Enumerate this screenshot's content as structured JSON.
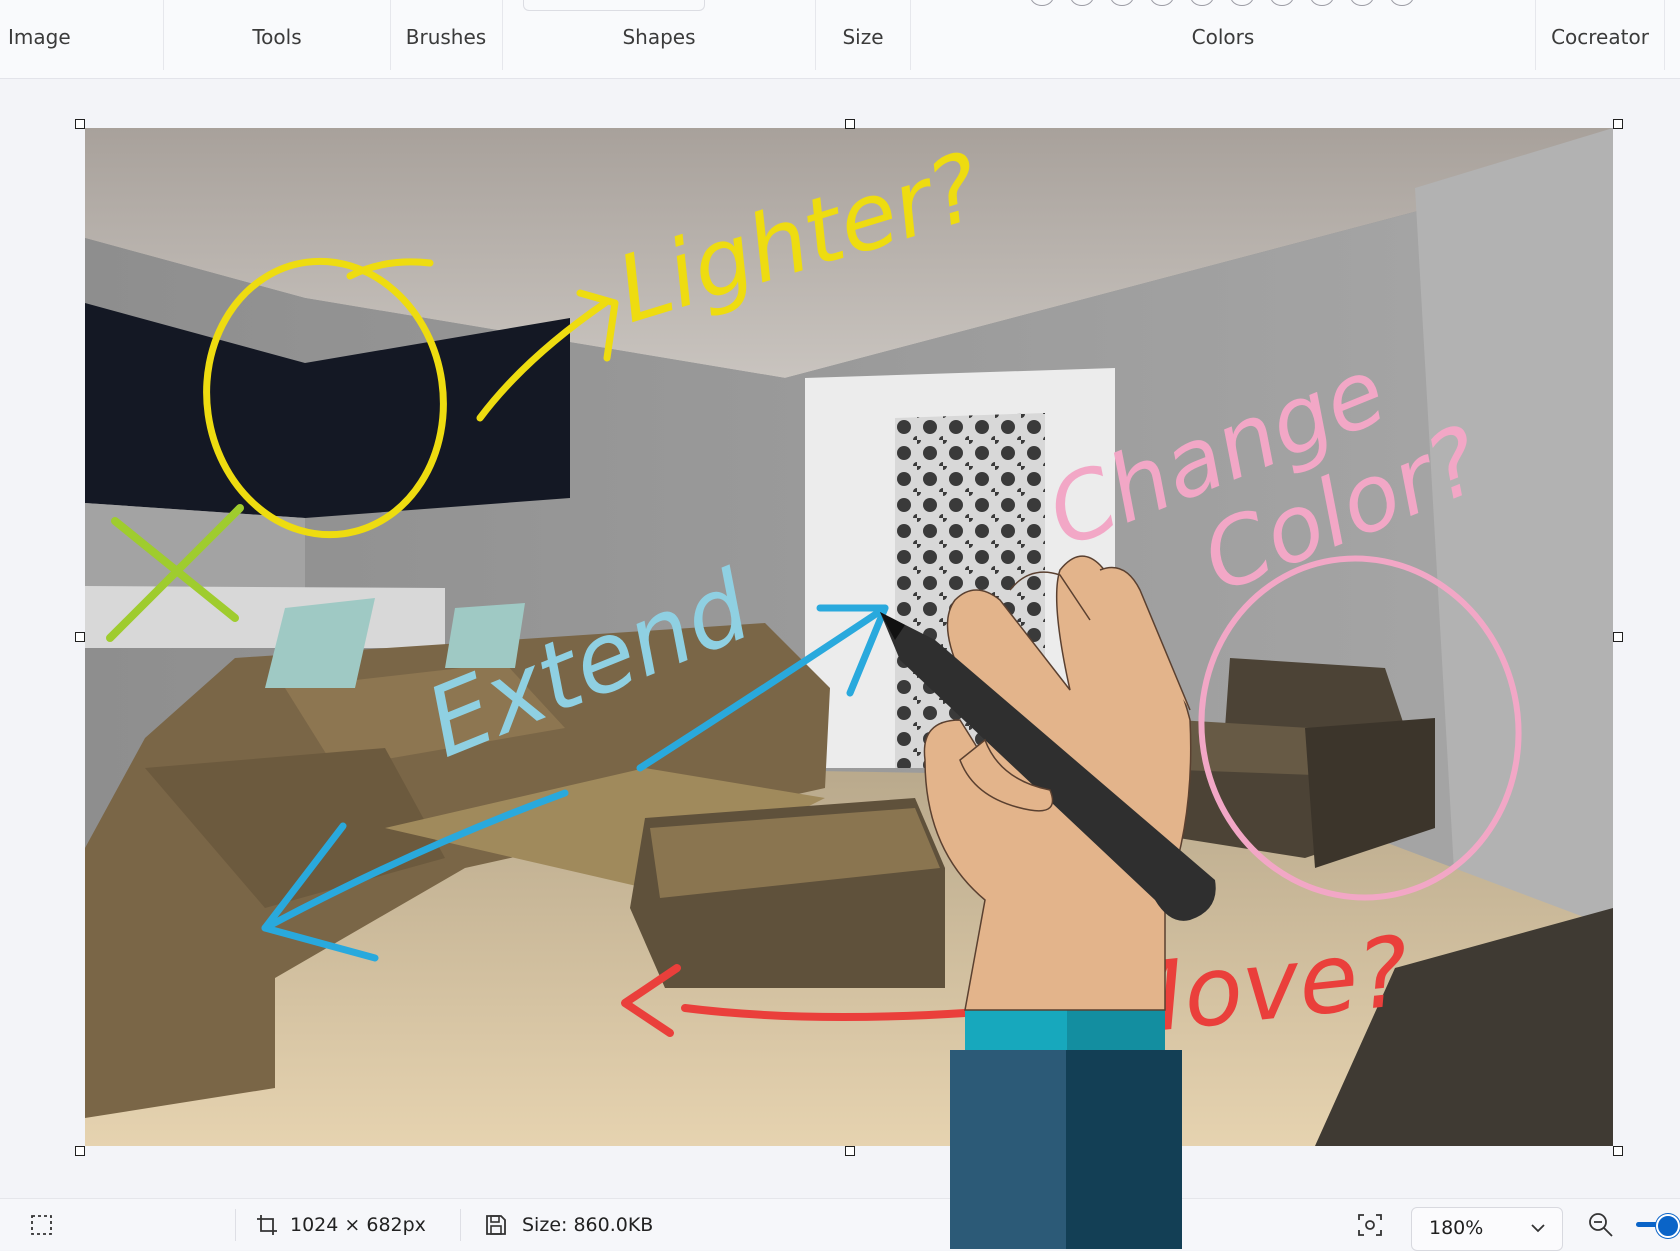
{
  "ribbon": {
    "groups": [
      "Image",
      "Tools",
      "Brushes",
      "Shapes",
      "Size",
      "Colors",
      "Cocreator"
    ]
  },
  "canvas": {
    "annotations": {
      "yellow": "Lighter?",
      "pink_line1": "Change",
      "pink_line2": "Color?",
      "blue": "Extend",
      "red": "Move?"
    }
  },
  "status": {
    "dimensions": "1024 × 682px",
    "size": "Size: 860.0KB",
    "zoom": "180%"
  },
  "colors": {
    "yellow": "#eedc10",
    "pink": "#f2a7c6",
    "blue": "#29a9dd",
    "light_blue": "#8fd0e2",
    "red": "#ea3f3b",
    "green": "#9fcc2e",
    "accent": "#0a64c8"
  },
  "icons": [
    "selection-icon",
    "canvas-size-icon",
    "save-icon",
    "focus-icon",
    "chevron-down-icon",
    "zoom-out-icon"
  ]
}
